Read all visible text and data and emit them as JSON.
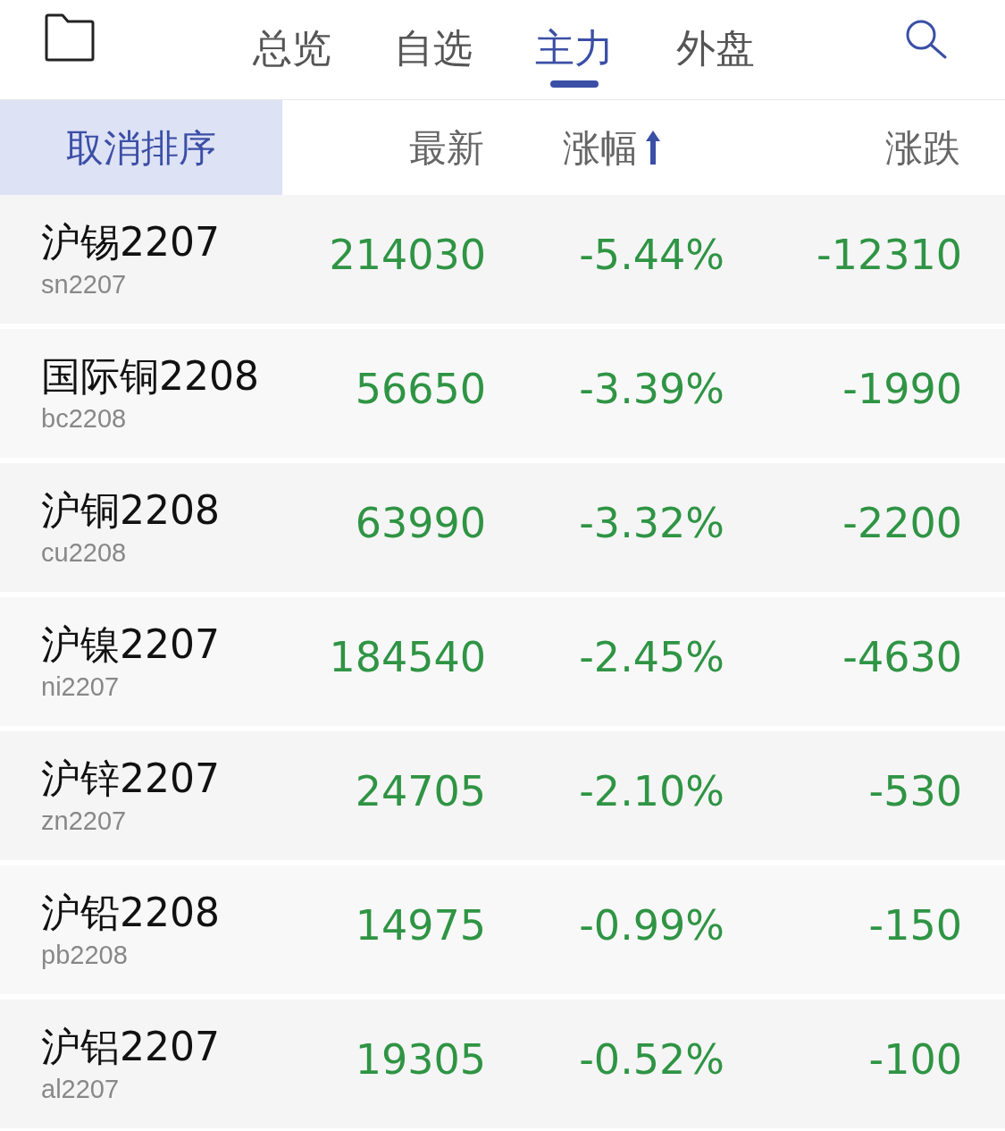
{
  "tabs": [
    {
      "label": "总览",
      "selected": false
    },
    {
      "label": "自选",
      "selected": false
    },
    {
      "label": "主力",
      "selected": true
    },
    {
      "label": "外盘",
      "selected": false
    }
  ],
  "sort_button": {
    "label": "取消排序",
    "selected": true
  },
  "columns": [
    {
      "label": "最新",
      "sorted": false
    },
    {
      "label": "涨幅",
      "sorted": true
    },
    {
      "label": "涨跌",
      "sorted": false
    }
  ],
  "rows": [
    {
      "name": "沪锡2207",
      "code": "sn2207",
      "price": "214030",
      "pct": "-5.44%",
      "change": "-12310"
    },
    {
      "name": "国际铜2208",
      "code": "bc2208",
      "price": "56650",
      "pct": "-3.39%",
      "change": "-1990"
    },
    {
      "name": "沪铜2208",
      "code": "cu2208",
      "price": "63990",
      "pct": "-3.32%",
      "change": "-2200"
    },
    {
      "name": "沪镍2207",
      "code": "ni2207",
      "price": "184540",
      "pct": "-2.45%",
      "change": "-4630"
    },
    {
      "name": "沪锌2207",
      "code": "zn2207",
      "price": "24705",
      "pct": "-2.10%",
      "change": "-530"
    },
    {
      "name": "沪铅2208",
      "code": "pb2208",
      "price": "14975",
      "pct": "-0.99%",
      "change": "-150"
    },
    {
      "name": "沪铝2207",
      "code": "al2207",
      "price": "19305",
      "pct": "-0.52%",
      "change": "-100"
    }
  ]
}
